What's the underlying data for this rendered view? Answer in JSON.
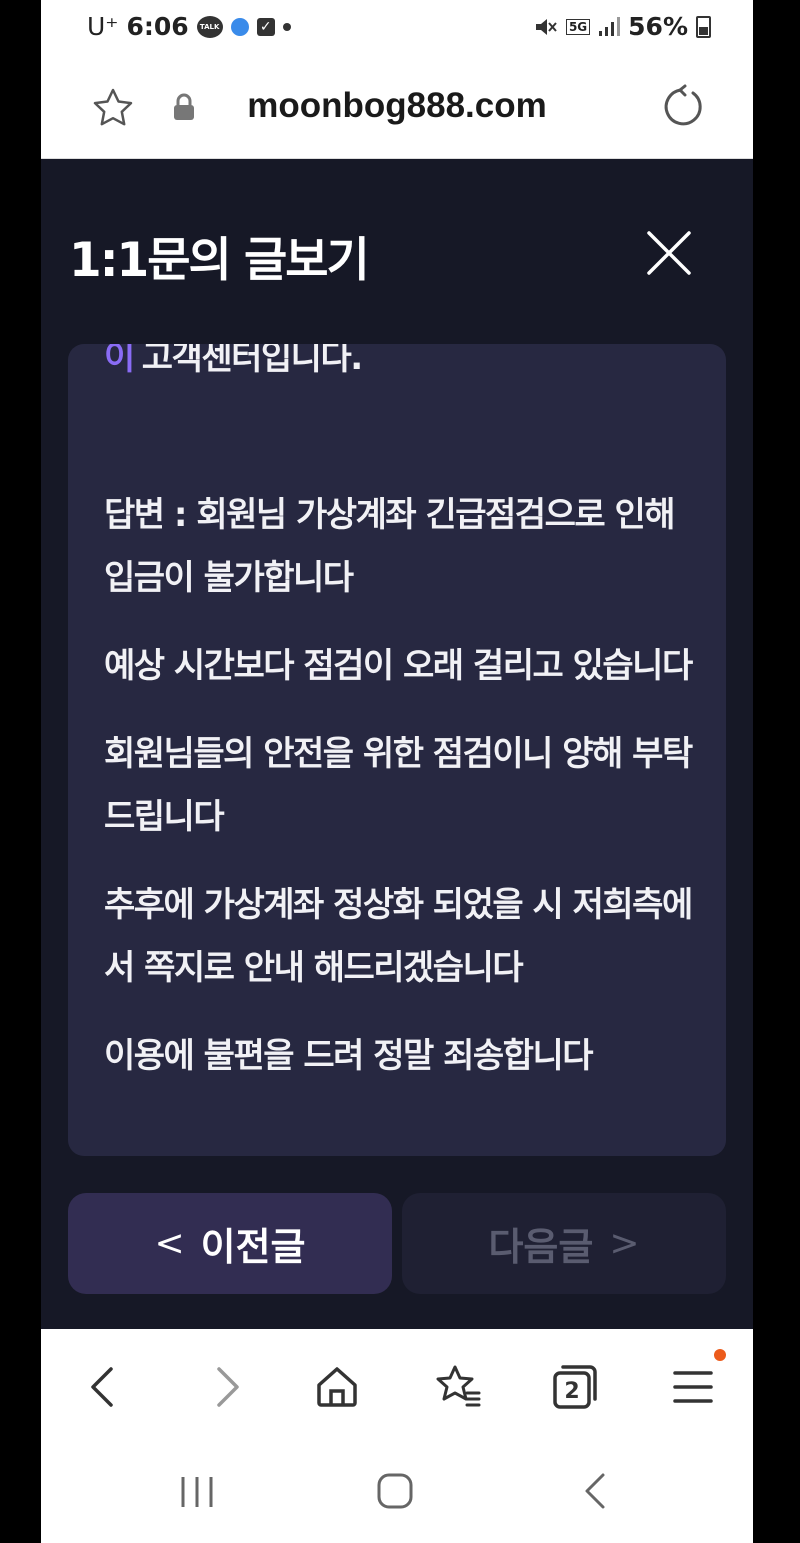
{
  "status_bar": {
    "carrier": "U⁺",
    "time": "6:06",
    "talk_label": "TALK",
    "network": "5G",
    "battery": "56%"
  },
  "address_bar": {
    "url": "moonbog888.com"
  },
  "page": {
    "title": "1:1문의 글보기",
    "content": {
      "first_line_accent": "이",
      "first_line_text": "고객센터입니다.",
      "paragraphs": [
        "답변 : 회원님 가상계좌 긴급점검으로 인해 입금이 불가합니다",
        "예상 시간보다 점검이 오래 걸리고 있습니다",
        "회원님들의 안전을 위한 점검이니 양해 부탁드립니다",
        "추후에 가상계좌 정상화 되었을 시 저희측에서 쪽지로 안내 해드리겠습니다",
        "이용에 불편을 드려 정말 죄송합니다"
      ]
    },
    "prev_button": {
      "chevron": "<",
      "label": "이전글"
    },
    "next_button": {
      "label": "다음글",
      "chevron": ">"
    }
  },
  "browser_nav": {
    "tab_count": "2"
  },
  "colors": {
    "page_bg": "#161826",
    "card_bg": "#272841",
    "accent": "#8a6cf5",
    "prev_button_bg": "#322d52",
    "next_button_bg": "#1f2033",
    "menu_badge": "#ec5b1b"
  }
}
